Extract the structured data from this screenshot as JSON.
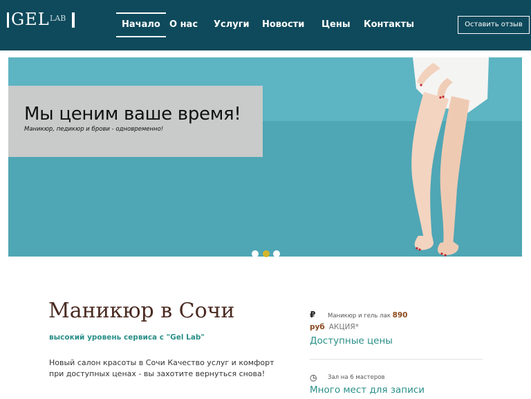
{
  "header": {
    "logo": {
      "main": "GEL",
      "sub": "LAB"
    },
    "nav": [
      {
        "label": "Начало",
        "active": true
      },
      {
        "label": "О нас",
        "active": false
      },
      {
        "label": "Услуги",
        "active": false
      },
      {
        "label": "Новости",
        "active": false
      },
      {
        "label": "Цены",
        "active": false
      },
      {
        "label": "Контакты",
        "active": false
      }
    ],
    "review_button": "Оставить отзыв"
  },
  "hero": {
    "title": "Мы ценим ваше время!",
    "subtitle": "Маникюр, педикюр и брови - одновременно!",
    "slide_count": 3,
    "active_slide": 2
  },
  "content": {
    "title": "Маникюр в Сочи",
    "tagline": "высокий уровень сервиса с \"Gel Lab\"",
    "description": "Новый салон красоты в Сочи Качество услуг и комфорт при доступных ценах - вы захотите вернуться снова!"
  },
  "features": [
    {
      "icon": "ruble-icon",
      "icon_glyph": "₽",
      "small_text": "Маникюр и гель лак",
      "price": "890",
      "currency": "руб",
      "promo": "АКЦИЯ*",
      "heading": "Доступные цены"
    },
    {
      "icon": "clock-icon",
      "icon_glyph": "◷",
      "small_text": "Зал на 6 мастеров",
      "heading": "Много мест для записи"
    }
  ],
  "colors": {
    "header_bg": "#0e4a5c",
    "accent_teal": "#2a8f88",
    "title_brown": "#4a2b22",
    "price_brown": "#8b4a1d",
    "active_dot": "#d4b62c",
    "hero_bg": "#56afbd"
  }
}
